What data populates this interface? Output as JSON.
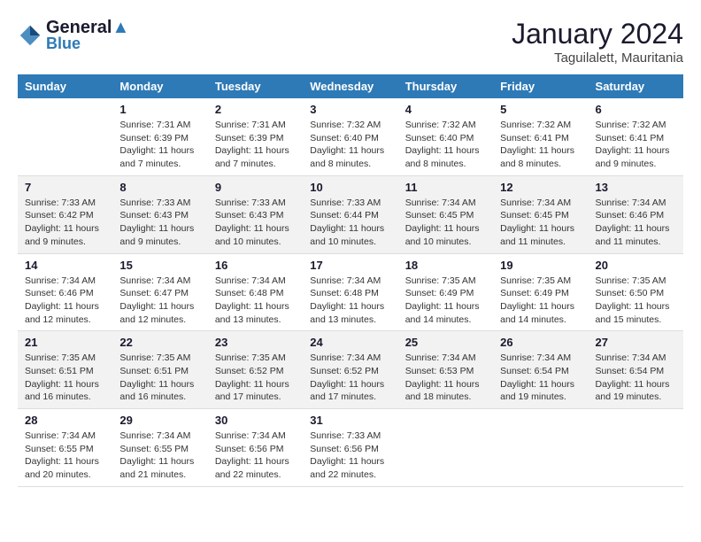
{
  "header": {
    "logo_line1": "General",
    "logo_line2": "Blue",
    "month": "January 2024",
    "location": "Taguilalett, Mauritania"
  },
  "days_of_week": [
    "Sunday",
    "Monday",
    "Tuesday",
    "Wednesday",
    "Thursday",
    "Friday",
    "Saturday"
  ],
  "weeks": [
    [
      {
        "day": "",
        "info": ""
      },
      {
        "day": "1",
        "info": "Sunrise: 7:31 AM\nSunset: 6:39 PM\nDaylight: 11 hours\nand 7 minutes."
      },
      {
        "day": "2",
        "info": "Sunrise: 7:31 AM\nSunset: 6:39 PM\nDaylight: 11 hours\nand 7 minutes."
      },
      {
        "day": "3",
        "info": "Sunrise: 7:32 AM\nSunset: 6:40 PM\nDaylight: 11 hours\nand 8 minutes."
      },
      {
        "day": "4",
        "info": "Sunrise: 7:32 AM\nSunset: 6:40 PM\nDaylight: 11 hours\nand 8 minutes."
      },
      {
        "day": "5",
        "info": "Sunrise: 7:32 AM\nSunset: 6:41 PM\nDaylight: 11 hours\nand 8 minutes."
      },
      {
        "day": "6",
        "info": "Sunrise: 7:32 AM\nSunset: 6:41 PM\nDaylight: 11 hours\nand 9 minutes."
      }
    ],
    [
      {
        "day": "7",
        "info": "Sunrise: 7:33 AM\nSunset: 6:42 PM\nDaylight: 11 hours\nand 9 minutes."
      },
      {
        "day": "8",
        "info": "Sunrise: 7:33 AM\nSunset: 6:43 PM\nDaylight: 11 hours\nand 9 minutes."
      },
      {
        "day": "9",
        "info": "Sunrise: 7:33 AM\nSunset: 6:43 PM\nDaylight: 11 hours\nand 10 minutes."
      },
      {
        "day": "10",
        "info": "Sunrise: 7:33 AM\nSunset: 6:44 PM\nDaylight: 11 hours\nand 10 minutes."
      },
      {
        "day": "11",
        "info": "Sunrise: 7:34 AM\nSunset: 6:45 PM\nDaylight: 11 hours\nand 10 minutes."
      },
      {
        "day": "12",
        "info": "Sunrise: 7:34 AM\nSunset: 6:45 PM\nDaylight: 11 hours\nand 11 minutes."
      },
      {
        "day": "13",
        "info": "Sunrise: 7:34 AM\nSunset: 6:46 PM\nDaylight: 11 hours\nand 11 minutes."
      }
    ],
    [
      {
        "day": "14",
        "info": "Sunrise: 7:34 AM\nSunset: 6:46 PM\nDaylight: 11 hours\nand 12 minutes."
      },
      {
        "day": "15",
        "info": "Sunrise: 7:34 AM\nSunset: 6:47 PM\nDaylight: 11 hours\nand 12 minutes."
      },
      {
        "day": "16",
        "info": "Sunrise: 7:34 AM\nSunset: 6:48 PM\nDaylight: 11 hours\nand 13 minutes."
      },
      {
        "day": "17",
        "info": "Sunrise: 7:34 AM\nSunset: 6:48 PM\nDaylight: 11 hours\nand 13 minutes."
      },
      {
        "day": "18",
        "info": "Sunrise: 7:35 AM\nSunset: 6:49 PM\nDaylight: 11 hours\nand 14 minutes."
      },
      {
        "day": "19",
        "info": "Sunrise: 7:35 AM\nSunset: 6:49 PM\nDaylight: 11 hours\nand 14 minutes."
      },
      {
        "day": "20",
        "info": "Sunrise: 7:35 AM\nSunset: 6:50 PM\nDaylight: 11 hours\nand 15 minutes."
      }
    ],
    [
      {
        "day": "21",
        "info": "Sunrise: 7:35 AM\nSunset: 6:51 PM\nDaylight: 11 hours\nand 16 minutes."
      },
      {
        "day": "22",
        "info": "Sunrise: 7:35 AM\nSunset: 6:51 PM\nDaylight: 11 hours\nand 16 minutes."
      },
      {
        "day": "23",
        "info": "Sunrise: 7:35 AM\nSunset: 6:52 PM\nDaylight: 11 hours\nand 17 minutes."
      },
      {
        "day": "24",
        "info": "Sunrise: 7:34 AM\nSunset: 6:52 PM\nDaylight: 11 hours\nand 17 minutes."
      },
      {
        "day": "25",
        "info": "Sunrise: 7:34 AM\nSunset: 6:53 PM\nDaylight: 11 hours\nand 18 minutes."
      },
      {
        "day": "26",
        "info": "Sunrise: 7:34 AM\nSunset: 6:54 PM\nDaylight: 11 hours\nand 19 minutes."
      },
      {
        "day": "27",
        "info": "Sunrise: 7:34 AM\nSunset: 6:54 PM\nDaylight: 11 hours\nand 19 minutes."
      }
    ],
    [
      {
        "day": "28",
        "info": "Sunrise: 7:34 AM\nSunset: 6:55 PM\nDaylight: 11 hours\nand 20 minutes."
      },
      {
        "day": "29",
        "info": "Sunrise: 7:34 AM\nSunset: 6:55 PM\nDaylight: 11 hours\nand 21 minutes."
      },
      {
        "day": "30",
        "info": "Sunrise: 7:34 AM\nSunset: 6:56 PM\nDaylight: 11 hours\nand 22 minutes."
      },
      {
        "day": "31",
        "info": "Sunrise: 7:33 AM\nSunset: 6:56 PM\nDaylight: 11 hours\nand 22 minutes."
      },
      {
        "day": "",
        "info": ""
      },
      {
        "day": "",
        "info": ""
      },
      {
        "day": "",
        "info": ""
      }
    ]
  ]
}
